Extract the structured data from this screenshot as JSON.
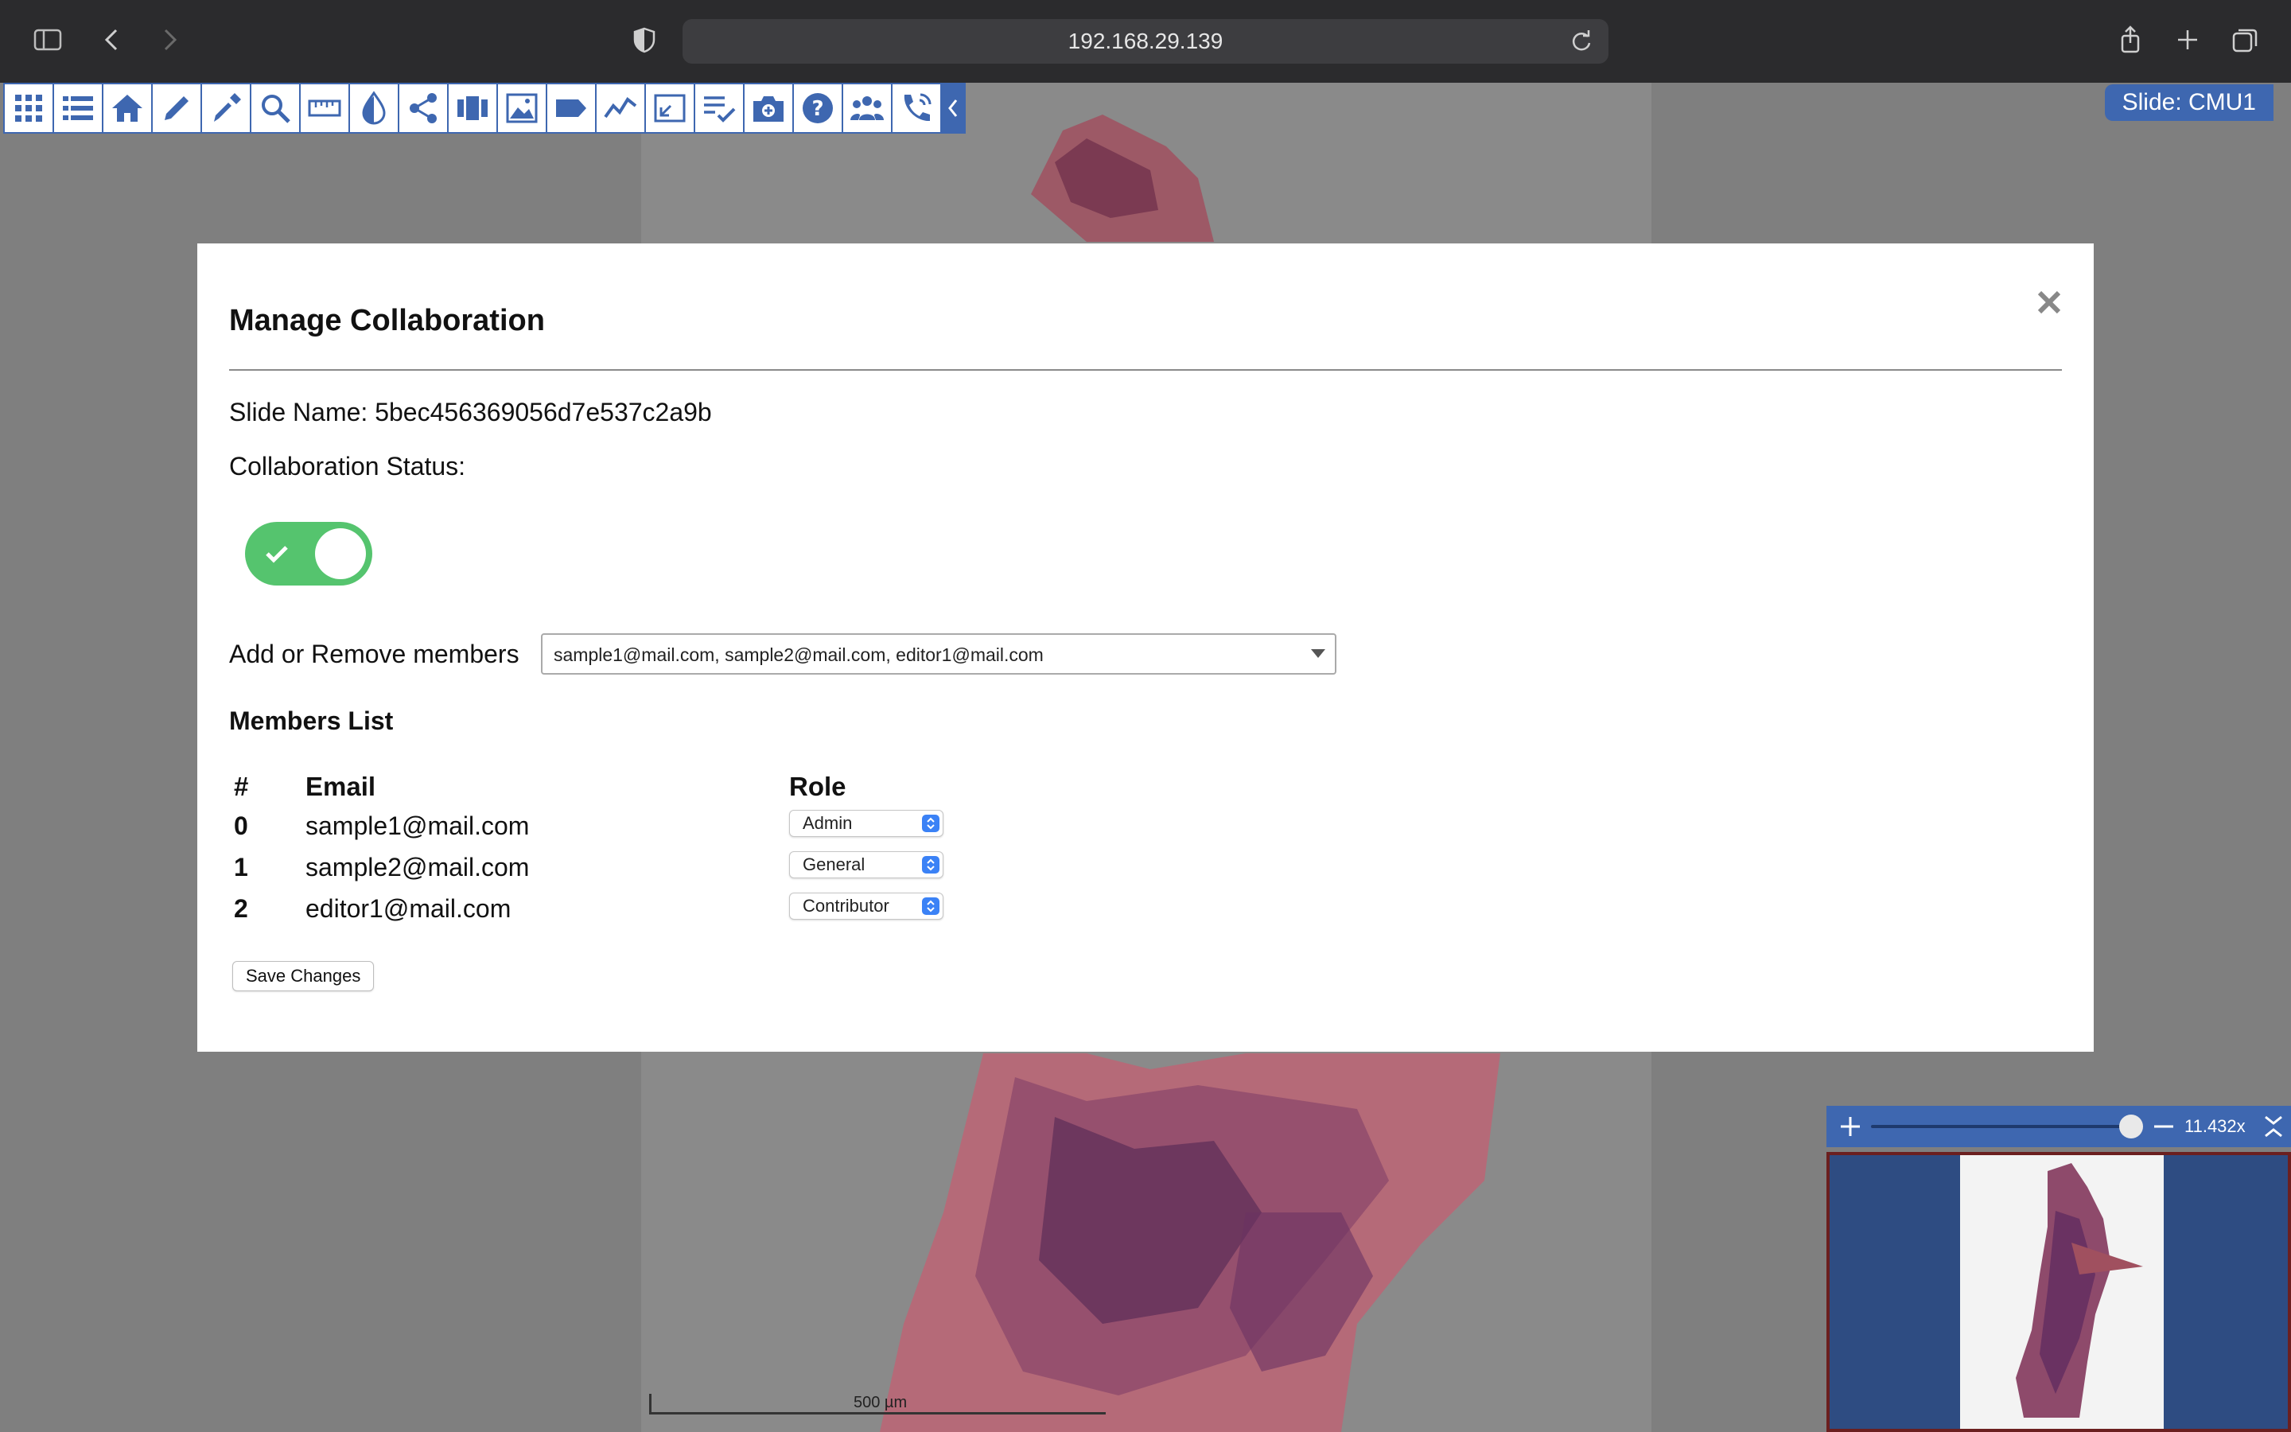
{
  "browser": {
    "url": "192.168.29.139"
  },
  "toolbar": {
    "icons": [
      "apps-icon",
      "list-icon",
      "home-icon",
      "pencil-icon",
      "color-picker-icon",
      "search-icon",
      "ruler-icon",
      "drop-icon",
      "share-icon",
      "split-view-icon",
      "image-icon",
      "label-icon",
      "line-chart-icon",
      "fullscreen-icon",
      "checklist-icon",
      "camera-icon",
      "help-icon",
      "people-icon",
      "call-icon",
      "collapse-icon"
    ]
  },
  "slide_label": "Slide: CMU1",
  "modal": {
    "title": "Manage Collaboration",
    "slide_name": "Slide Name: 5bec456369056d7e537c2a9b",
    "collab_status_label": "Collaboration Status:",
    "collab_enabled": true,
    "add_remove_label": "Add or Remove members",
    "members_selected": "sample1@mail.com, sample2@mail.com, editor1@mail.com",
    "members_list_title": "Members List",
    "columns": {
      "index": "#",
      "email": "Email",
      "role": "Role"
    },
    "members": [
      {
        "index": "0",
        "email": "sample1@mail.com",
        "role": "Admin"
      },
      {
        "index": "1",
        "email": "sample2@mail.com",
        "role": "General"
      },
      {
        "index": "2",
        "email": "editor1@mail.com",
        "role": "Contributor"
      }
    ],
    "save_label": "Save Changes"
  },
  "navigator": {
    "zoom": "11.432x"
  },
  "scalebar": {
    "label": "500 µm"
  }
}
